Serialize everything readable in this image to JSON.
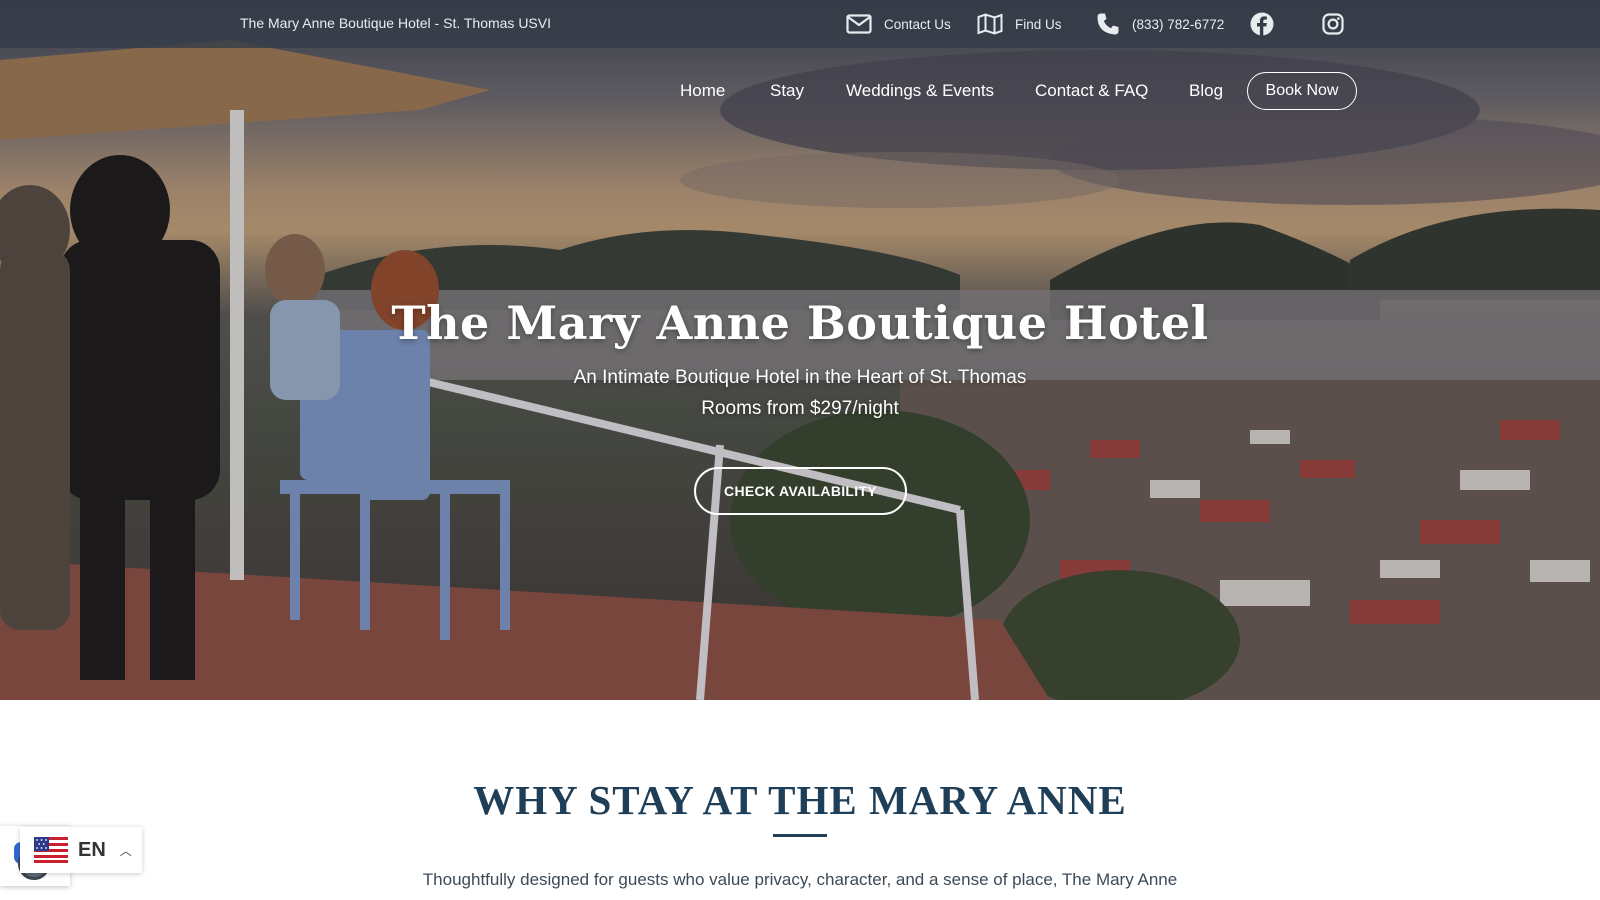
{
  "topbar": {
    "tagline": "The Mary Anne Boutique Hotel - St. Thomas USVI",
    "contact_label": "Contact Us",
    "find_label": "Find Us",
    "phone": "(833) 782-6772"
  },
  "nav": {
    "items": [
      "Home",
      "Stay",
      "Weddings & Events",
      "Contact & FAQ",
      "Blog"
    ],
    "book_label": "Book Now"
  },
  "hero": {
    "title": "The Mary Anne Boutique Hotel",
    "subtitle": "An Intimate Boutique Hotel in the Heart of St. Thomas",
    "price": "Rooms from $297/night",
    "cta": "CHECK AVAILABILITY"
  },
  "section": {
    "heading": "WHY STAY AT THE MARY ANNE",
    "intro": "Thoughtfully designed for guests who value privacy, character, and a sense of place, The Mary Anne"
  },
  "language": {
    "code": "EN"
  },
  "colors": {
    "heading": "#1f3e57",
    "topbar": "#343c48"
  }
}
